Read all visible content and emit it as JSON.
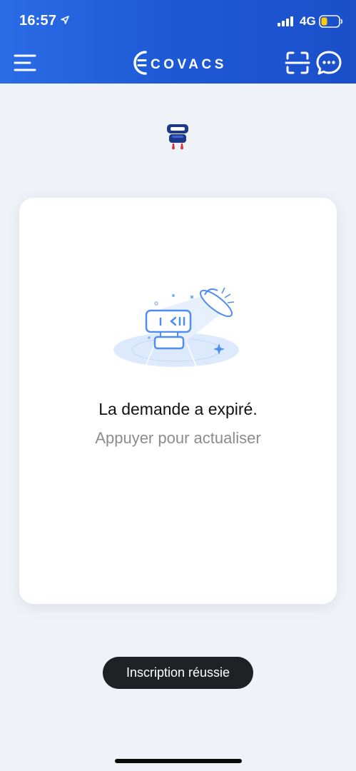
{
  "status_bar": {
    "time": "16:57",
    "network": "4G"
  },
  "header": {
    "brand": "ECOVACS"
  },
  "card": {
    "title": "La demande a expiré.",
    "subtitle": "Appuyer pour actualiser"
  },
  "toast": {
    "message": "Inscription réussie"
  },
  "colors": {
    "header_blue": "#1e5ad6",
    "background": "#eff2f7",
    "battery_level": "#ffcc00",
    "illustration_blue": "#4d8ef0",
    "robot_navy": "#1d3a8a",
    "robot_red": "#e03040"
  }
}
